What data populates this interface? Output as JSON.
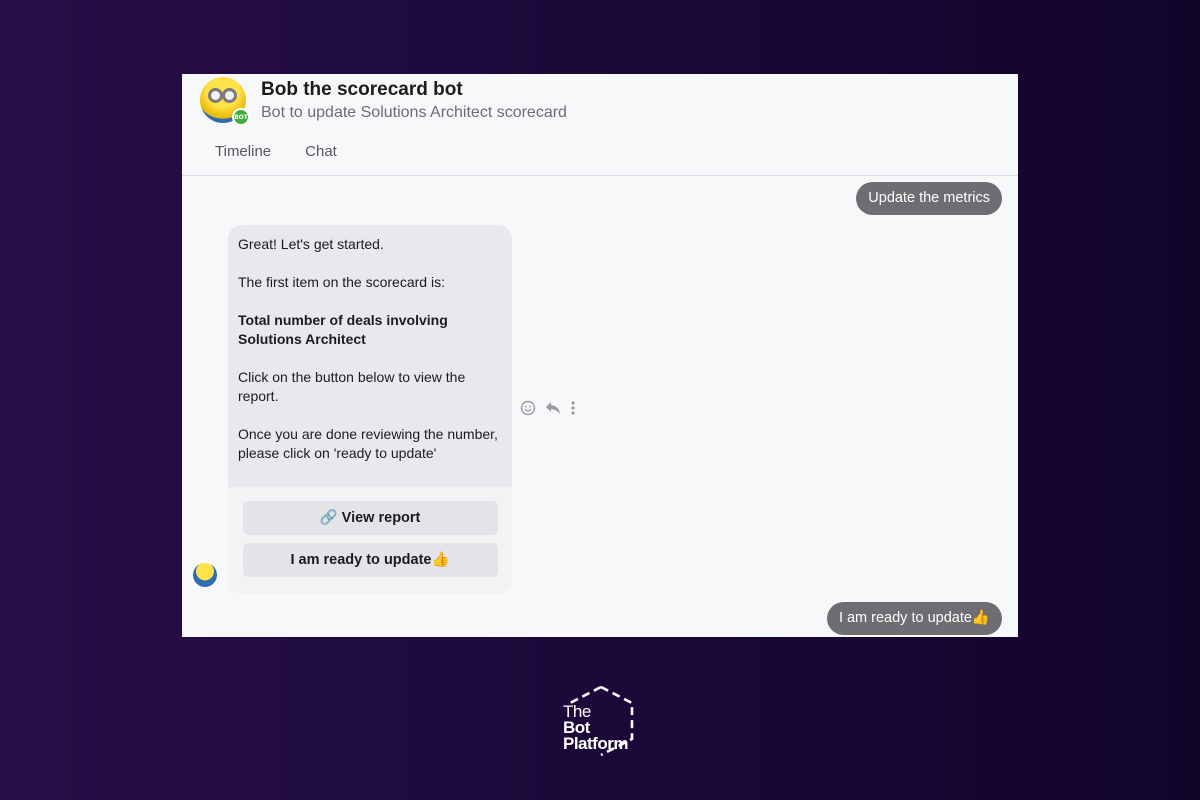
{
  "header": {
    "title": "Bob the scorecard bot",
    "subtitle": "Bot to update Solutions Architect scorecard",
    "badge": "BOT",
    "tabs": [
      {
        "label": "Timeline"
      },
      {
        "label": "Chat"
      }
    ]
  },
  "messages": {
    "user_first": "Update the metrics",
    "bot": {
      "lines": [
        "Great! Let's get started.",
        "The first item on the scorecard is:",
        "Total number of deals involving Solutions Architect",
        "Click on the button below to view the report.",
        "Once you are done reviewing the number, please click on 'ready to update'"
      ],
      "buttons": [
        {
          "label": "🔗 View report"
        },
        {
          "label": "I am ready to update👍"
        }
      ]
    },
    "user_last": "I am ready to update👍"
  },
  "tools": {
    "react_icon": "smiley-icon",
    "reply_icon": "reply-icon",
    "more_icon": "more-vertical-icon"
  },
  "branding": {
    "line1": "The",
    "line2": "Bot",
    "line3": "Platform"
  },
  "colors": {
    "background": "#1a0838",
    "user_bubble": "#6e6e72",
    "bot_bubble": "#e8e9ec",
    "accent_badge": "#3fae3f"
  }
}
